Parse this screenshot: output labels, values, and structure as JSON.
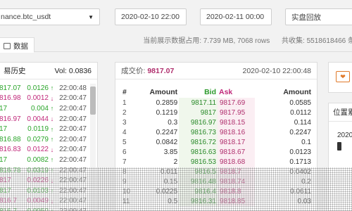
{
  "controls": {
    "exchange_select": "nance.btc_usdt",
    "start_date": "2020-02-10 22:00",
    "end_date": "2020-02-11 00:00",
    "mode": "实盘回放"
  },
  "stats": {
    "data_usage": "当前展示数据占用: 7.739 MB, 7068 rows",
    "total": "共收集: 5518618466 条"
  },
  "tab": {
    "label": "数据"
  },
  "trade_history": {
    "title": "易历史",
    "vol_label": "Vol: 0.0836",
    "rows": [
      {
        "price": "817.07",
        "qty": "0.0126",
        "dir": "↑",
        "dir_class": "up",
        "time": "22:00:48"
      },
      {
        "price": "816.98",
        "qty": "0.0012",
        "dir": "↓",
        "dir_class": "down",
        "time": "22:00:47"
      },
      {
        "price": "17",
        "qty": "0.004",
        "dir": "↑",
        "dir_class": "up",
        "time": "22:00:47"
      },
      {
        "price": "816.97",
        "qty": "0.0044",
        "dir": "↓",
        "dir_class": "down",
        "time": "22:00:47"
      },
      {
        "price": "17",
        "qty": "0.0119",
        "dir": "↑",
        "dir_class": "up",
        "time": "22:00:47"
      },
      {
        "price": "816.88",
        "qty": "0.0279",
        "dir": "↑",
        "dir_class": "up",
        "time": "22:00:47"
      },
      {
        "price": "816.83",
        "qty": "0.0122",
        "dir": "↓",
        "dir_class": "down",
        "time": "22:00:47"
      },
      {
        "price": "17",
        "qty": "0.0082",
        "dir": "↑",
        "dir_class": "up",
        "time": "22:00:47"
      },
      {
        "price": "816.78",
        "qty": "0.0319",
        "dir": "↑",
        "dir_class": "up",
        "time": "22:00:47"
      },
      {
        "price": "817",
        "qty": "0.0226",
        "dir": "↓",
        "dir_class": "down",
        "time": "22:00:47"
      },
      {
        "price": "817",
        "qty": "0.0103",
        "dir": "↑",
        "dir_class": "up",
        "time": "22:00:47"
      },
      {
        "price": "816.7",
        "qty": "0.0049",
        "dir": "↓",
        "dir_class": "down",
        "time": "22:00:47"
      },
      {
        "price": "816.7",
        "qty": "0.0050",
        "dir": "↑",
        "dir_class": "up",
        "time": "22:00:47"
      }
    ]
  },
  "order_book": {
    "price_label": "成交价:",
    "price_value": "9817.07",
    "timestamp": "2020-02-10 22:00:48",
    "headers": {
      "idx": "#",
      "amount": "Amount",
      "bid": "Bid",
      "ask": "Ask",
      "amount2": "Amount"
    },
    "rows": [
      {
        "idx": "1",
        "amount": "0.2859",
        "bid": "9817.11",
        "ask": "9817.69",
        "amount2": "0.0585"
      },
      {
        "idx": "2",
        "amount": "0.1219",
        "bid": "9817",
        "ask": "9817.95",
        "amount2": "0.0112"
      },
      {
        "idx": "3",
        "amount": "0.3",
        "bid": "9816.97",
        "ask": "9818.15",
        "amount2": "0.114"
      },
      {
        "idx": "4",
        "amount": "0.2247",
        "bid": "9816.73",
        "ask": "9818.16",
        "amount2": "0.2247"
      },
      {
        "idx": "5",
        "amount": "0.0842",
        "bid": "9816.72",
        "ask": "9818.17",
        "amount2": "0.1"
      },
      {
        "idx": "6",
        "amount": "3.85",
        "bid": "9816.63",
        "ask": "9818.67",
        "amount2": "0.0123"
      },
      {
        "idx": "7",
        "amount": "2",
        "bid": "9816.53",
        "ask": "9818.68",
        "amount2": "0.1713"
      },
      {
        "idx": "8",
        "amount": "0.011",
        "bid": "9816.5",
        "ask": "9818.7",
        "amount2": "0.0402"
      },
      {
        "idx": "9",
        "amount": "0.15",
        "bid": "9816.48",
        "ask": "9818.74",
        "amount2": "0.2"
      },
      {
        "idx": "10",
        "amount": "0.0225",
        "bid": "9816.4",
        "ask": "9818.8",
        "amount2": "0.0611"
      },
      {
        "idx": "11",
        "amount": "0.5",
        "bid": "9816.31",
        "ask": "9818.85",
        "amount2": "0.03"
      }
    ]
  },
  "right_panel": {
    "mini_button": "❤",
    "title": "位置累",
    "date": "2020"
  },
  "colors": {
    "bid_green": "#2a9a2a",
    "ask_magenta": "#c0287a",
    "accent_orange": "#e07a2a"
  }
}
